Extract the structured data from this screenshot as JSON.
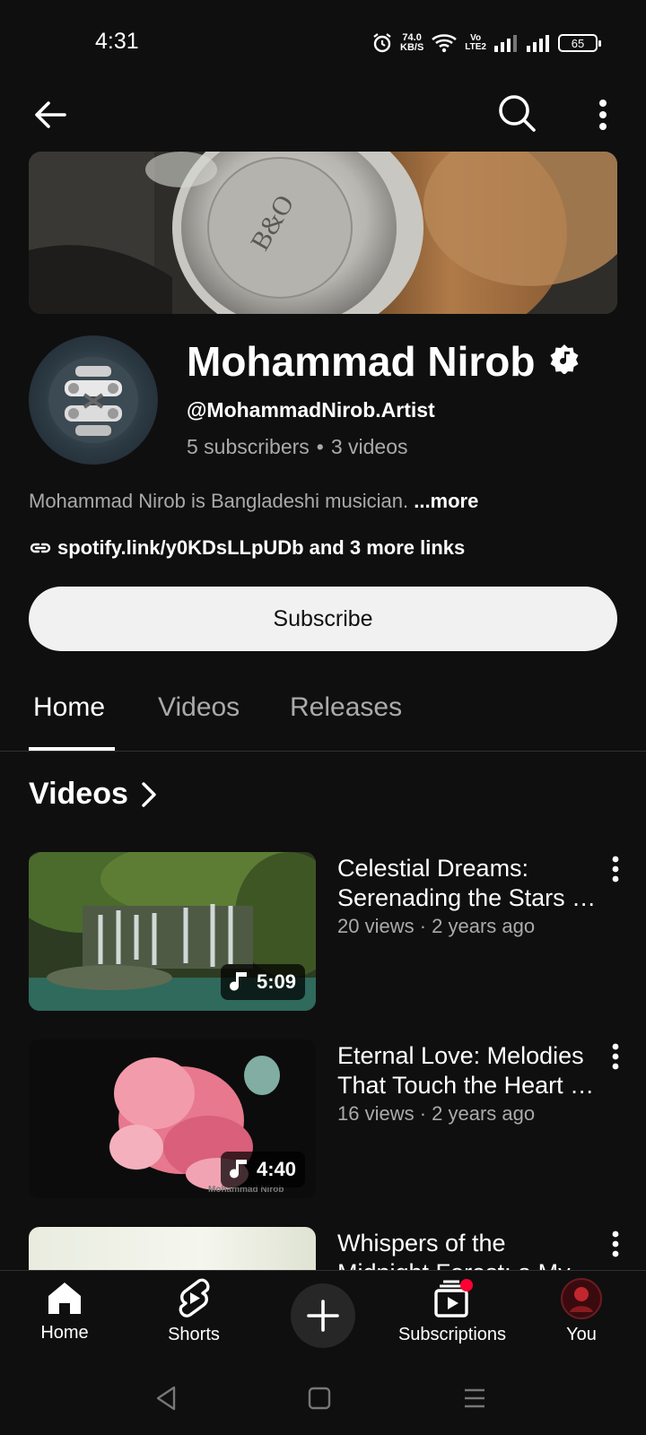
{
  "status_bar": {
    "time": "4:31",
    "speed_value": "74.0",
    "speed_unit": "KB/S",
    "volte_top": "Vo",
    "volte_bottom": "LTE2",
    "battery": "65"
  },
  "channel": {
    "name": "Mohammad Nirob",
    "handle": "@MohammadNirob.Artist",
    "subscribers": "5 subscribers",
    "separator": "•",
    "videos_count": "3 videos",
    "description": "Mohammad Nirob is Bangladeshi musician.",
    "more_label": "...more",
    "link": "spotify.link/y0KDsLLpUDb",
    "more_links": "and 3 more links",
    "subscribe_label": "Subscribe",
    "banner_logo": "B&O"
  },
  "tabs": [
    {
      "label": "Home",
      "active": true
    },
    {
      "label": "Videos",
      "active": false
    },
    {
      "label": "Releases",
      "active": false
    }
  ],
  "section": {
    "title": "Videos"
  },
  "videos": [
    {
      "title": "Celestial Dreams: Serenading the Stars …",
      "meta": "20 views · 2 years ago",
      "duration": "5:09"
    },
    {
      "title": "Eternal Love: Melodies That Touch the Heart …",
      "meta": "16 views · 2 years ago",
      "duration": "4:40",
      "watermark": "Mohammad Nirob"
    },
    {
      "title": "Whispers of the Midnight Forest: a My…",
      "meta": "",
      "duration": ""
    }
  ],
  "bottom_nav": [
    {
      "label": "Home",
      "icon": "home-icon"
    },
    {
      "label": "Shorts",
      "icon": "shorts-icon"
    },
    {
      "label": "",
      "icon": "plus-icon"
    },
    {
      "label": "Subscriptions",
      "icon": "subscriptions-icon"
    },
    {
      "label": "You",
      "icon": "avatar"
    }
  ],
  "colors": {
    "background": "#0f0f0f",
    "text_primary": "#f1f1f1",
    "text_secondary": "#aaaaaa",
    "subscribe_bg": "#f1f1f1",
    "notification_dot": "#ff0033"
  }
}
